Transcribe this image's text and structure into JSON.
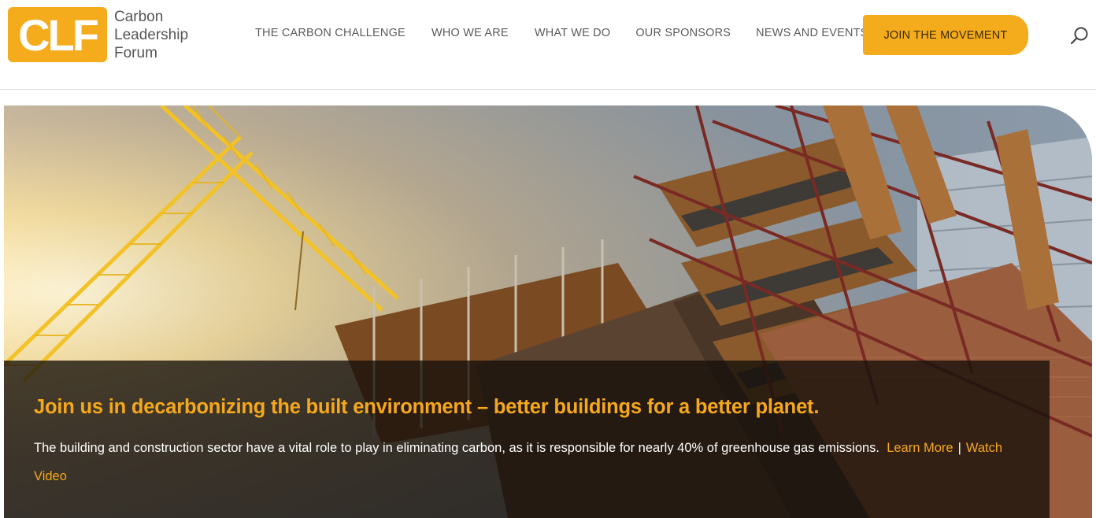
{
  "brand": {
    "mark": "CLF",
    "name_lines": [
      "Carbon",
      "Leadership",
      "Forum"
    ],
    "accent_color": "#f5ac1c"
  },
  "nav": {
    "items": [
      {
        "label": "THE CARBON CHALLENGE"
      },
      {
        "label": "WHO WE ARE"
      },
      {
        "label": "WHAT WE DO"
      },
      {
        "label": "OUR SPONSORS"
      },
      {
        "label": "NEWS AND EVENTS"
      }
    ],
    "cta_label": "JOIN THE MOVEMENT",
    "search_icon": "search-icon"
  },
  "hero": {
    "image": "construction-site-crane-scaffolding",
    "headline": "Join us in decarbonizing the built environment – better buildings for a better planet.",
    "body": "The building and construction sector have a vital role to play in eliminating carbon, as it is responsible for nearly 40% of greenhouse gas emissions.",
    "learn_more_label": "Learn More",
    "separator": "|",
    "watch_video_label": "Watch Video"
  }
}
